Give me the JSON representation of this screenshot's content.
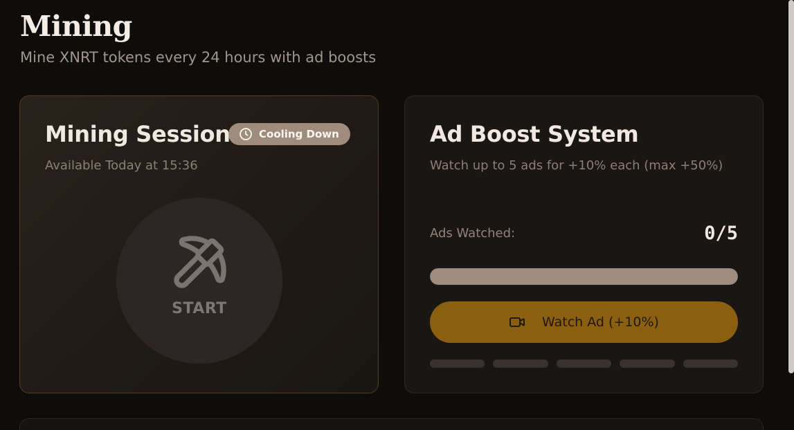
{
  "header": {
    "title": "Mining",
    "subtitle": "Mine XNRT tokens every 24 hours with ad boosts"
  },
  "mining_card": {
    "title": "Mining Session",
    "status_badge": "Cooling Down",
    "status_icon": "clock-icon",
    "availability": "Available Today at 15:36",
    "start_label": "START",
    "start_icon": "pickaxe-icon"
  },
  "ad_card": {
    "title": "Ad Boost System",
    "description": "Watch up to 5 ads for +10% each (max +50%)",
    "ads_watched_label": "Ads Watched:",
    "ads_watched_count": "0/5",
    "ads_watched": 0,
    "ads_max": 5,
    "progress_fraction": 0,
    "watch_button_label": "Watch Ad (+10%)",
    "watch_button_icon": "video-camera-icon",
    "segments": [
      {
        "filled": false
      },
      {
        "filled": false
      },
      {
        "filled": false
      },
      {
        "filled": false
      },
      {
        "filled": false
      }
    ]
  },
  "colors": {
    "background": "#0f0d0c",
    "accent_gold": "#8a5f10",
    "badge": "#a08c7c"
  }
}
